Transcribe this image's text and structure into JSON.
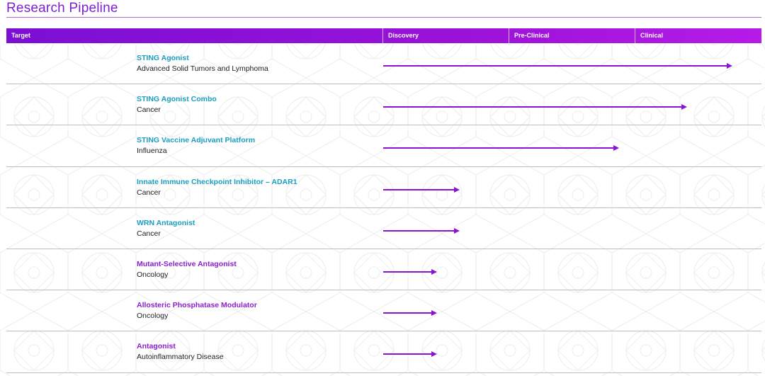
{
  "page": {
    "title": "Research Pipeline"
  },
  "columns": [
    "Target",
    "Discovery",
    "Pre-Clinical",
    "Clinical"
  ],
  "programs": [
    {
      "name": "STING Agonist",
      "indication": "Advanced Solid Tumors and Lymphoma",
      "color": "#1a9fc0",
      "progress": 0.91
    },
    {
      "name": "STING Agonist Combo",
      "indication": "Cancer",
      "color": "#1a9fc0",
      "progress": 0.79
    },
    {
      "name": "STING Vaccine Adjuvant Platform",
      "indication": "Influenza",
      "color": "#1a9fc0",
      "progress": 0.61
    },
    {
      "name": "Innate Immune Checkpoint Inhibitor – ADAR1",
      "indication": "Cancer",
      "color": "#1a9fc0",
      "progress": 0.19
    },
    {
      "name": "WRN Antagonist",
      "indication": "Cancer",
      "color": "#1a9fc0",
      "progress": 0.19
    },
    {
      "name": "Mutant-Selective Antagonist",
      "indication": "Oncology",
      "color": "#8a1fd0",
      "progress": 0.13
    },
    {
      "name": "Allosteric Phosphatase Modulator",
      "indication": "Oncology",
      "color": "#8a1fd0",
      "progress": 0.13
    },
    {
      "name": "Antagonist",
      "indication": "Autoinflammatory Disease",
      "color": "#8a1fd0",
      "progress": 0.13
    }
  ],
  "colors": {
    "accent": "#7b1fd1",
    "arrow": "#8a14d6",
    "teal": "#1a9fc0"
  }
}
